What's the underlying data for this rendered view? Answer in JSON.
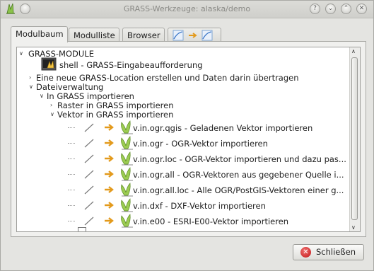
{
  "window": {
    "title": "GRASS-Werkzeuge: alaska/demo"
  },
  "title_buttons": [
    "?",
    "⌄",
    "⌃",
    "✕"
  ],
  "tabs": [
    {
      "label": "Modulbaum"
    },
    {
      "label": "Modulliste"
    },
    {
      "label": "Browser"
    }
  ],
  "tree": {
    "root": "GRASS-MODULE",
    "shell": "shell - GRASS-Eingabeaufforderung",
    "new_location": "Eine neue GRASS-Location erstellen und Daten darin übertragen",
    "dateiverwaltung": "Dateiverwaltung",
    "import": "In GRASS importieren",
    "raster_import": "Raster in GRASS importieren",
    "vector_import": "Vektor in GRASS importieren",
    "modules": [
      "v.in.ogr.qgis - Geladenen Vektor importieren",
      "v.in.ogr - OGR-Vektor importieren",
      "v.in.ogr.loc - OGR-Vektor importieren und dazu pas...",
      "v.in.ogr.all - OGR-Vektoren aus gegebener Quelle i...",
      "v.in.ogr.all.loc - Alle OGR/PostGIS-Vektoren einer g...",
      "v.in.dxf - DXF-Vektor importieren",
      "v.in.e00 - ESRI-E00-Vektor importieren"
    ]
  },
  "buttons": {
    "close": "Schließen"
  }
}
